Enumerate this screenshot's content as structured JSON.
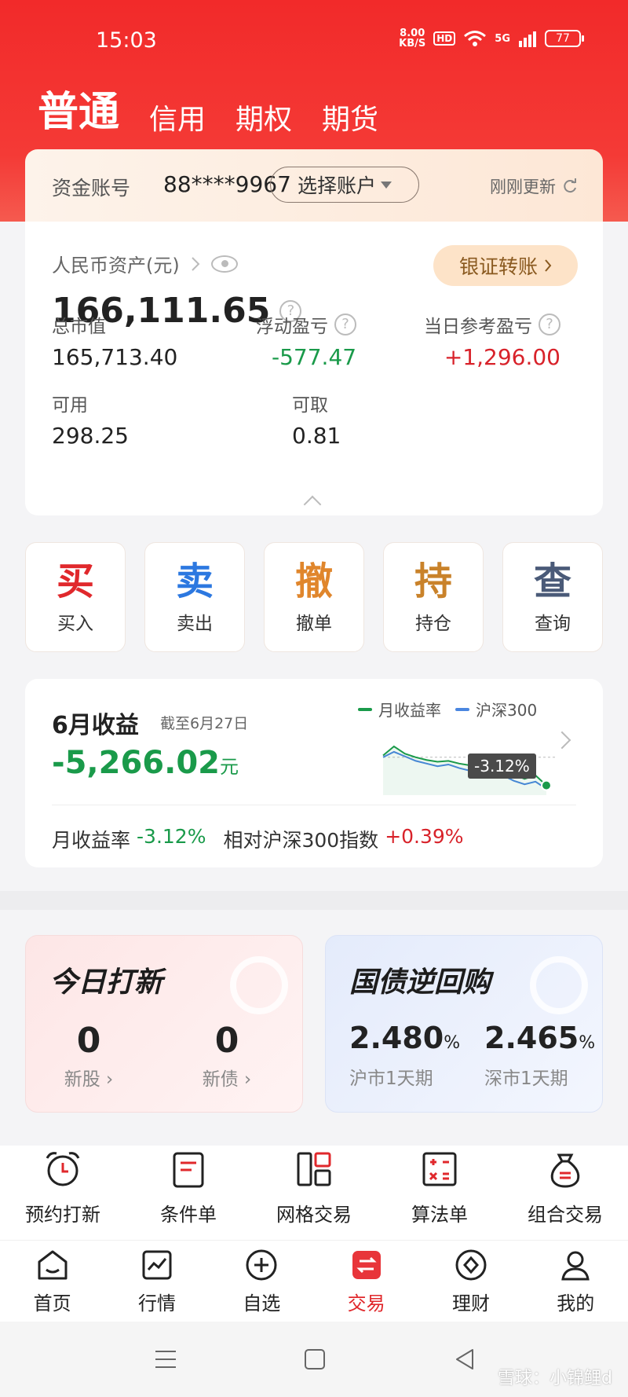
{
  "status_bar": {
    "time": "15:03",
    "speed_value": "8.00",
    "speed_unit": "KB/S",
    "hd": "HD",
    "network": "5G",
    "battery": "77"
  },
  "tabs": [
    {
      "label": "普通",
      "active": true
    },
    {
      "label": "信用"
    },
    {
      "label": "期权"
    },
    {
      "label": "期货"
    }
  ],
  "account": {
    "label": "资金账号",
    "number": "88****9967",
    "select_label": "选择账户",
    "refresh_label": "刚刚更新"
  },
  "assets": {
    "title": "人民币资产(元)",
    "total": "166,111.65",
    "transfer_label": "银证转账",
    "market_value_label": "总市值",
    "market_value": "165,713.40",
    "floating_pl_label": "浮动盈亏",
    "floating_pl": "-577.47",
    "daily_pl_label": "当日参考盈亏",
    "daily_pl": "+1,296.00",
    "available_label": "可用",
    "available": "298.25",
    "withdrawable_label": "可取",
    "withdrawable": "0.81"
  },
  "actions": [
    {
      "glyph": "买",
      "label": "买入",
      "color": "#e0282c"
    },
    {
      "glyph": "卖",
      "label": "卖出",
      "color": "#2c78e0"
    },
    {
      "glyph": "撤",
      "label": "撤单",
      "color": "#e0862c"
    },
    {
      "glyph": "持",
      "label": "持仓",
      "color": "#c9822a"
    },
    {
      "glyph": "查",
      "label": "查询",
      "color": "#4a5a78"
    }
  ],
  "monthly": {
    "title": "6月收益",
    "as_of": "截至6月27日",
    "value": "-5,266.02",
    "unit": "元",
    "legend_monthly": "月收益率",
    "legend_index": "沪深300",
    "badge": "-3.12%",
    "rate_label": "月收益率",
    "rate_value": "-3.12%",
    "relative_label": "相对沪深300指数",
    "relative_value": "+0.39%",
    "colors": {
      "monthly": "#1a9a4a",
      "index": "#4a86e0"
    },
    "chart_data": {
      "type": "line",
      "series": [
        {
          "name": "月收益率",
          "values": [
            0.2,
            1.2,
            0.4,
            0.0,
            -0.3,
            -0.5,
            -0.4,
            -0.7,
            -0.9,
            -0.8,
            -1.1,
            -1.4,
            -1.9,
            -2.4,
            -2.0,
            -3.12
          ]
        },
        {
          "name": "沪深300",
          "values": [
            0.0,
            0.6,
            0.1,
            -0.4,
            -0.7,
            -1.0,
            -0.8,
            -1.2,
            -1.5,
            -1.3,
            -1.6,
            -2.0,
            -2.6,
            -3.0,
            -2.7,
            -3.5
          ]
        }
      ]
    }
  },
  "ipo": {
    "title": "今日打新",
    "stocks_count": "0",
    "stocks_label": "新股",
    "bonds_count": "0",
    "bonds_label": "新债"
  },
  "repo": {
    "title": "国债逆回购",
    "sh_rate": "2.480",
    "sh_label": "沪市1天期",
    "sz_rate": "2.465",
    "sz_label": "深市1天期",
    "pct": "%"
  },
  "shortcuts": [
    {
      "label": "预约打新",
      "icon": "alarm-clock-icon"
    },
    {
      "label": "条件单",
      "icon": "document-icon"
    },
    {
      "label": "网格交易",
      "icon": "grid-icon"
    },
    {
      "label": "算法单",
      "icon": "calculator-icon"
    },
    {
      "label": "组合交易",
      "icon": "money-bag-icon"
    }
  ],
  "nav": [
    {
      "label": "首页",
      "icon": "home-icon"
    },
    {
      "label": "行情",
      "icon": "chart-icon"
    },
    {
      "label": "自选",
      "icon": "plus-circle-icon"
    },
    {
      "label": "交易",
      "icon": "trade-icon",
      "active": true
    },
    {
      "label": "理财",
      "icon": "diamond-icon"
    },
    {
      "label": "我的",
      "icon": "user-icon"
    }
  ],
  "watermark": "雪球：小锦鲤d"
}
